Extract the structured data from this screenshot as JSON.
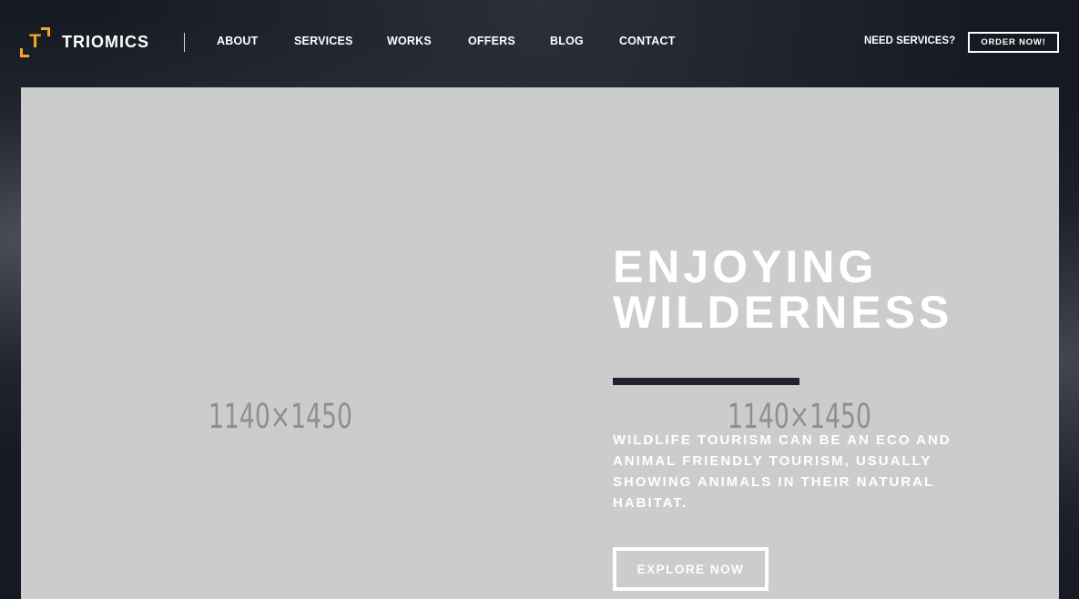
{
  "brand": {
    "name": "TRIOMICS",
    "mark": "T",
    "accent_color": "#f5a623"
  },
  "nav": {
    "items": [
      {
        "label": "ABOUT"
      },
      {
        "label": "SERVICES"
      },
      {
        "label": "WORKS"
      },
      {
        "label": "OFFERS"
      },
      {
        "label": "BLOG"
      },
      {
        "label": "CONTACT"
      }
    ]
  },
  "header_cta": {
    "prompt": "NEED SERVICES?",
    "button_label": "ORDER NOW!"
  },
  "hero": {
    "title_line1": "ENJOYING",
    "title_line2": "WILDERNESS",
    "description": "WILDLIFE TOURISM CAN BE AN ECO AND ANIMAL FRIENDLY TOURISM, USUALLY SHOWING ANIMALS IN THEIR NATURAL HABITAT.",
    "button_label": "EXPLORE NOW",
    "background_color": "#cccccc",
    "placeholders": [
      {
        "label": "1140×1450"
      },
      {
        "label": "1140×1450"
      }
    ]
  }
}
